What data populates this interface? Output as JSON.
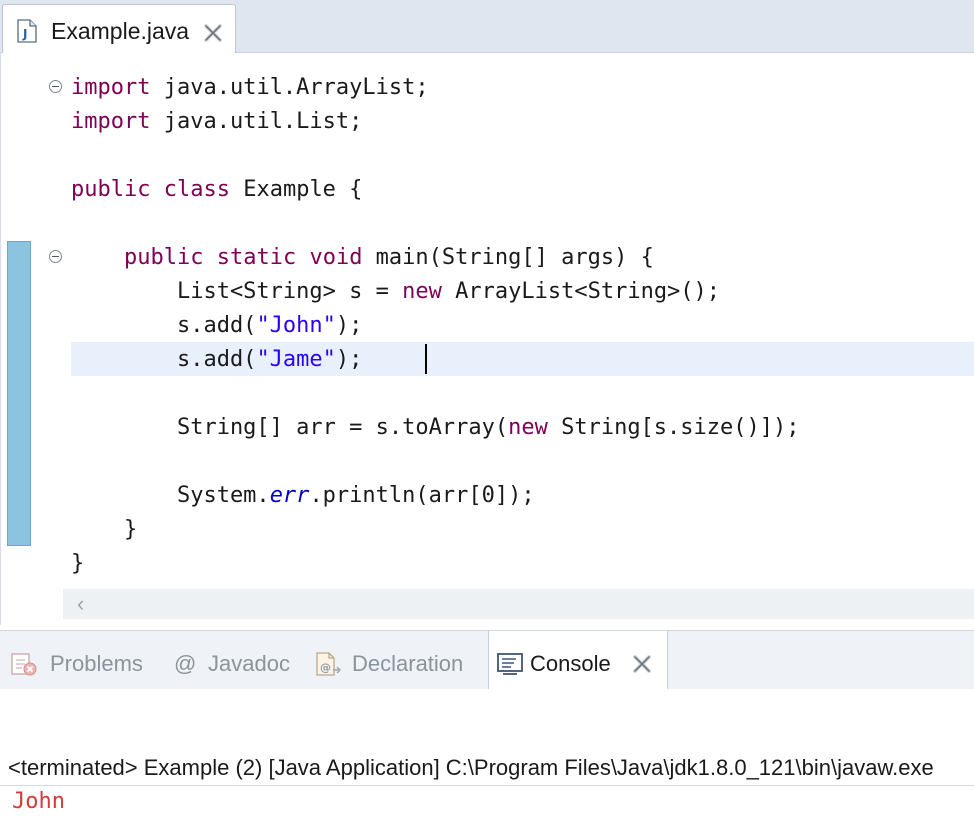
{
  "editor": {
    "tab_label": "Example.java",
    "code": {
      "l1_kw": "import",
      "l1_rest": " java.util.ArrayList;",
      "l2_kw": "import",
      "l2_rest": " java.util.List;",
      "l3_kw1": "public",
      "l3_sp": " ",
      "l3_kw2": "class",
      "l3_rest": " Example {",
      "l4_indent": "    ",
      "l4_kw1": "public",
      "l4_kw2": "static",
      "l4_kw3": "void",
      "l4_rest": " main(String[] args) {",
      "l5_a": "        List<String> s = ",
      "l5_kw": "new",
      "l5_b": " ArrayList<String>();",
      "l6_a": "        s.add(",
      "l6_str": "\"John\"",
      "l6_b": ");",
      "l7_a": "        s.add(",
      "l7_str": "\"Jame\"",
      "l7_b": ");",
      "l8_a": "        String[] arr = s.toArray(",
      "l8_kw": "new",
      "l8_b": " String[s.size()]);",
      "l9_a": "        System.",
      "l9_fld": "err",
      "l9_b": ".println(arr[0]);",
      "l10": "    }",
      "l11": "}"
    },
    "scroll_left": "‹"
  },
  "views": {
    "tabs": [
      {
        "label": "Problems"
      },
      {
        "label": "Javadoc"
      },
      {
        "label": "Declaration"
      },
      {
        "label": "Console"
      }
    ]
  },
  "console": {
    "header": "<terminated> Example (2) [Java Application] C:\\Program Files\\Java\\jdk1.8.0_121\\bin\\javaw.exe",
    "output": "John"
  },
  "colors": {
    "keyword": "#7f0055",
    "string": "#2a00ff",
    "field": "#0000c0",
    "stderr": "#d33a3a",
    "change_ruler": "#8cc3de"
  }
}
